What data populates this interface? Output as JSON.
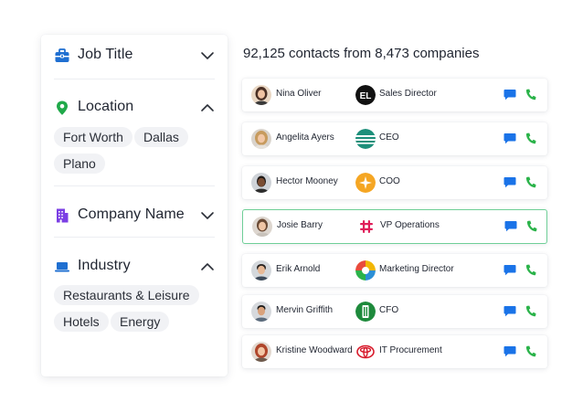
{
  "filters": {
    "job_title": {
      "label": "Job Title",
      "icon": "briefcase-icon",
      "expanded": false
    },
    "location": {
      "label": "Location",
      "icon": "map-pin-icon",
      "expanded": true,
      "chips": [
        "Fort Worth",
        "Dallas",
        "Plano"
      ]
    },
    "company_name": {
      "label": "Company Name",
      "icon": "building-icon",
      "expanded": false
    },
    "industry": {
      "label": "Industry",
      "icon": "laptop-icon",
      "expanded": true,
      "chips": [
        "Restaurants & Leisure",
        "Hotels",
        "Energy"
      ]
    }
  },
  "results": {
    "headline": "92,125 contacts from 8,473 companies",
    "contacts": [
      {
        "name": "Nina Oliver",
        "title": "Sales Director",
        "company_logo": "el-logo-icon"
      },
      {
        "name": "Angelita Ayers",
        "title": "CEO",
        "company_logo": "striped-globe-logo-icon"
      },
      {
        "name": "Hector Mooney",
        "title": "COO",
        "company_logo": "orange-star-logo-icon"
      },
      {
        "name": "Josie Barry",
        "title": "VP Operations",
        "company_logo": "slack-logo-icon",
        "selected": true
      },
      {
        "name": "Erik Arnold",
        "title": "Marketing Director",
        "company_logo": "sun-globe-logo-icon"
      },
      {
        "name": "Mervin Griffith",
        "title": "CFO",
        "company_logo": "green-tower-logo-icon"
      },
      {
        "name": "Kristine Woodward",
        "title": "IT Procurement",
        "company_logo": "toyota-logo-icon"
      }
    ]
  },
  "colors": {
    "brand_blue": "#1a73e8",
    "call_green": "#2bb34a",
    "selected_border": "#6fcf97",
    "filter_icon_blue": "#1f6fd1",
    "filter_icon_green": "#20a94a",
    "filter_icon_purple": "#7b3fe4"
  }
}
